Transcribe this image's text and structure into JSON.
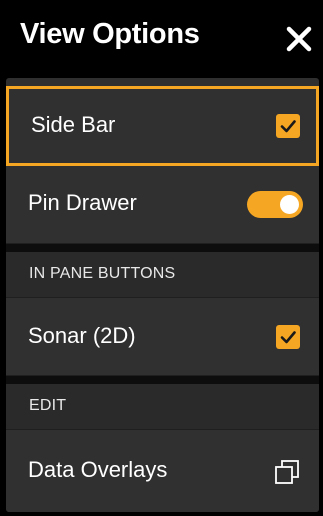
{
  "header": {
    "title": "View Options",
    "close_icon": "close-icon"
  },
  "rows": {
    "side_bar": {
      "label": "Side Bar",
      "checked": true
    },
    "pin_drawer": {
      "label": "Pin Drawer",
      "toggle_on": true
    }
  },
  "sections": {
    "in_pane_buttons": "IN PANE BUTTONS",
    "edit": "EDIT"
  },
  "in_pane": {
    "sonar_2d": {
      "label": "Sonar (2D)",
      "checked": true
    }
  },
  "edit": {
    "data_overlays": {
      "label": "Data Overlays",
      "icon": "overlay-windows-icon"
    }
  },
  "colors": {
    "accent": "#f5a623",
    "background": "#000000",
    "row": "#303030"
  }
}
